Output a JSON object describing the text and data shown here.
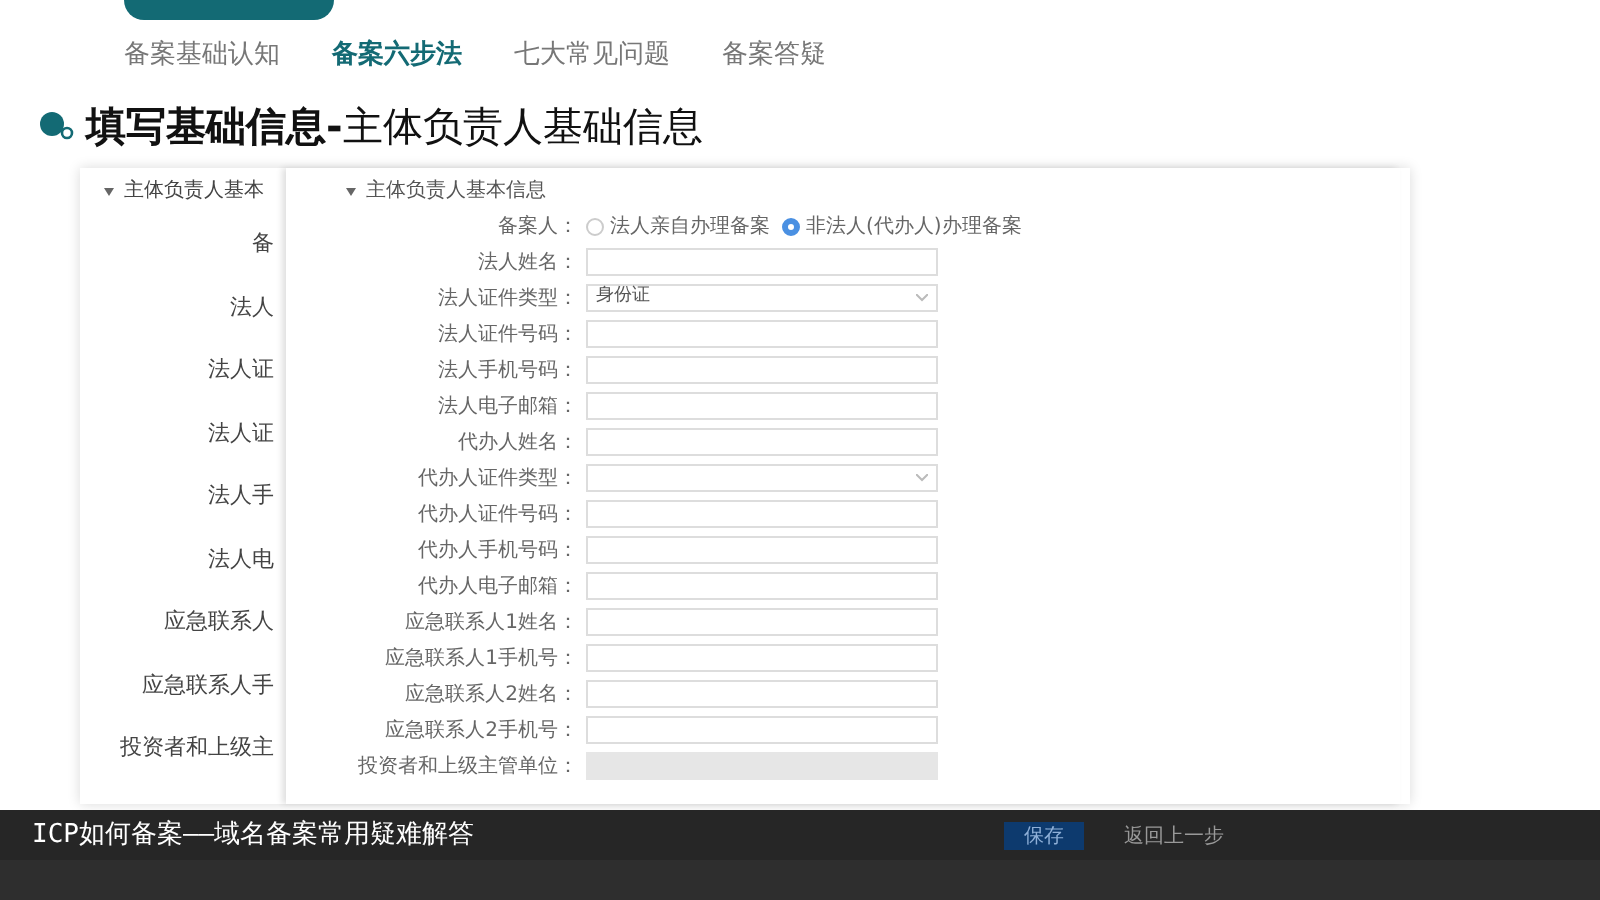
{
  "tabs": [
    {
      "label": "备案基础认知",
      "selected": false
    },
    {
      "label": "备案六步法",
      "selected": true
    },
    {
      "label": "七大常见问题",
      "selected": false
    },
    {
      "label": "备案答疑",
      "selected": false
    }
  ],
  "title": "**填写基础信息-**主体负责人基础信息",
  "background_form": {
    "section": "主体负责人基本",
    "labels": [
      "备",
      "法人",
      "法人证",
      "法人证",
      "法人手",
      "法人电",
      "应急联系人",
      "应急联系人手",
      "投资者和上级主"
    ]
  },
  "form": {
    "section": "主体负责人基本信息",
    "rows": [
      {
        "kind": "radio",
        "label": "备案人：",
        "options": [
          {
            "label": "法人亲自办理备案",
            "selected": false
          },
          {
            "label": "非法人(代办人)办理备案",
            "selected": true
          }
        ]
      },
      {
        "kind": "text",
        "label": "法人姓名：",
        "disabled": false
      },
      {
        "kind": "select",
        "label": "法人证件类型：",
        "value": "身份证"
      },
      {
        "kind": "text",
        "label": "法人证件号码：",
        "disabled": false
      },
      {
        "kind": "text",
        "label": "法人手机号码：",
        "disabled": false
      },
      {
        "kind": "text",
        "label": "法人电子邮箱：",
        "disabled": false
      },
      {
        "kind": "text",
        "label": "代办人姓名：",
        "disabled": false
      },
      {
        "kind": "select",
        "label": "代办人证件类型："
      },
      {
        "kind": "text",
        "label": "代办人证件号码：",
        "disabled": false
      },
      {
        "kind": "text",
        "label": "代办人手机号码：",
        "disabled": false
      },
      {
        "kind": "text",
        "label": "代办人电子邮箱：",
        "disabled": false
      },
      {
        "kind": "text",
        "label": "应急联系人1姓名：",
        "disabled": false
      },
      {
        "kind": "text",
        "label": "应急联系人1手机号：",
        "disabled": false
      },
      {
        "kind": "text",
        "label": "应急联系人2姓名：",
        "disabled": false
      },
      {
        "kind": "text",
        "label": "应急联系人2手机号：",
        "disabled": false
      },
      {
        "kind": "text",
        "label": "投资者和上级主管单位：",
        "disabled": true
      }
    ]
  },
  "caption": "ICP如何备案——域名备案常用疑难解答",
  "buttons": [
    {
      "label": "保存",
      "kind": "primary"
    },
    {
      "label": "返回上一步",
      "kind": "default"
    }
  ]
}
